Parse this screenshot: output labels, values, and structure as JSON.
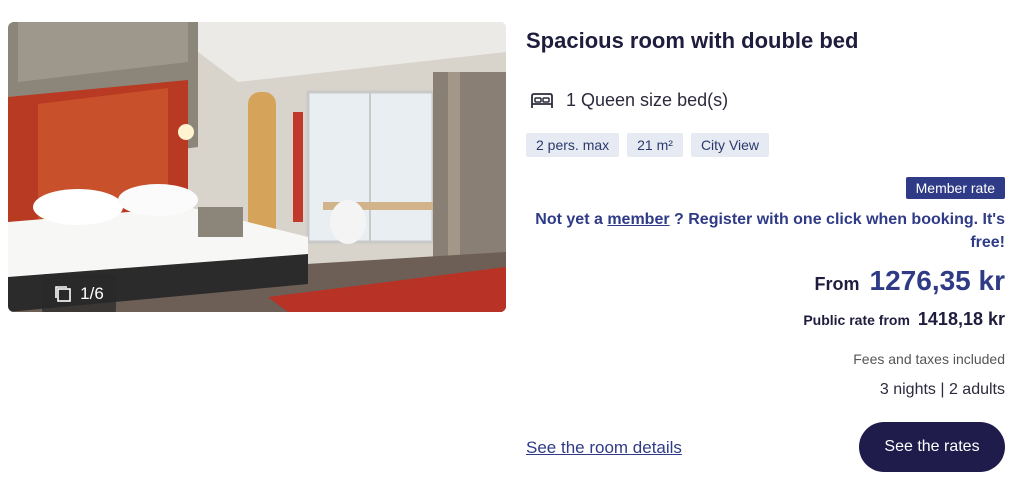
{
  "room": {
    "title": "Spacious room with double bed",
    "bed": "1 Queen size bed(s)",
    "tags": [
      "2 pers. max",
      "21 m²",
      "City View"
    ]
  },
  "gallery": {
    "counter": "1/6"
  },
  "pricing": {
    "member_badge": "Member rate",
    "member_prefix": "Not yet a",
    "member_link": "member",
    "member_suffix": "? Register with one click when booking. It's free!",
    "from_label": "From",
    "price": "1276,35 kr",
    "public_label": "Public rate from",
    "public_price": "1418,18 kr",
    "fees": "Fees and taxes included",
    "stay": "3 nights | 2 adults"
  },
  "actions": {
    "details_link": "See the room details",
    "rates_button": "See the rates"
  },
  "colors": {
    "accent": "#2f3b86",
    "button": "#1f1b4b",
    "tag_bg": "#e6eaf3"
  }
}
